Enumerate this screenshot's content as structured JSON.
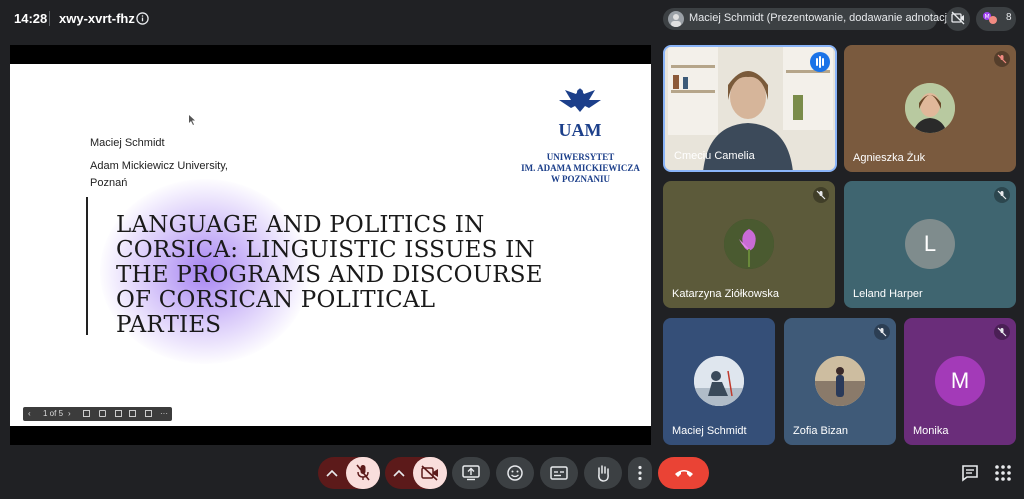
{
  "topbar": {
    "time": "14:28",
    "meeting_code": "xwy-xvrt-fhz",
    "presenter_text": "Maciej Schmidt (Prezentowanie, dodawanie adnotacji)",
    "participant_count": "8"
  },
  "slide": {
    "author": "Maciej Schmidt",
    "affiliation_line1": "Adam Mickiewicz University,",
    "affiliation_line2": "Poznań",
    "title_lines": [
      "LANGUAGE AND POLITICS IN",
      "CORSICA: LINGUISTIC ISSUES IN",
      "THE PROGRAMS AND DISCOURSE",
      "OF CORSICAN POLITICAL",
      "PARTIES"
    ],
    "logo_text_line1": "UNIWERSYTET",
    "logo_text_line2": "IM. ADAMA MICKIEWICZA",
    "logo_text_line3": "W POZNANIU",
    "logo_mark": "UAM",
    "page_indicator": "1 of 5"
  },
  "participants": [
    {
      "name": "Cmeciu Camelia",
      "kind": "video",
      "speaking": true
    },
    {
      "name": "Agnieszka Żuk",
      "kind": "photo",
      "muted": true,
      "bg": "#7a5a3e"
    },
    {
      "name": "Katarzyna Ziółkowska",
      "kind": "photo",
      "muted": true,
      "bg": "#5c5a3a"
    },
    {
      "name": "Leland Harper",
      "kind": "letter",
      "letter": "L",
      "muted": true,
      "bg": "#3f6570",
      "avatar_color": "#7f8c8d"
    },
    {
      "name": "Maciej Schmidt",
      "kind": "photo",
      "muted": false,
      "bg": "#354f78"
    },
    {
      "name": "Zofia Bizan",
      "kind": "photo",
      "muted": true,
      "bg": "#3f5a78"
    },
    {
      "name": "Monika",
      "kind": "letter",
      "letter": "M",
      "muted": true,
      "bg": "#6a2d7a",
      "avatar_color": "#a33ab8"
    }
  ],
  "colors": {
    "end_call": "#ea4335",
    "muted_red": "#f9dedc",
    "button_bg": "#3c4043",
    "accent_blue": "#8ab4f8"
  },
  "icons": [
    "info-icon",
    "camera-off-icon",
    "people-icon",
    "mic-off-icon",
    "camera-off-icon",
    "present-icon",
    "emoji-icon",
    "captions-icon",
    "raise-hand-icon",
    "more-vert-icon",
    "end-call-icon",
    "chat-icon",
    "activities-icon"
  ]
}
